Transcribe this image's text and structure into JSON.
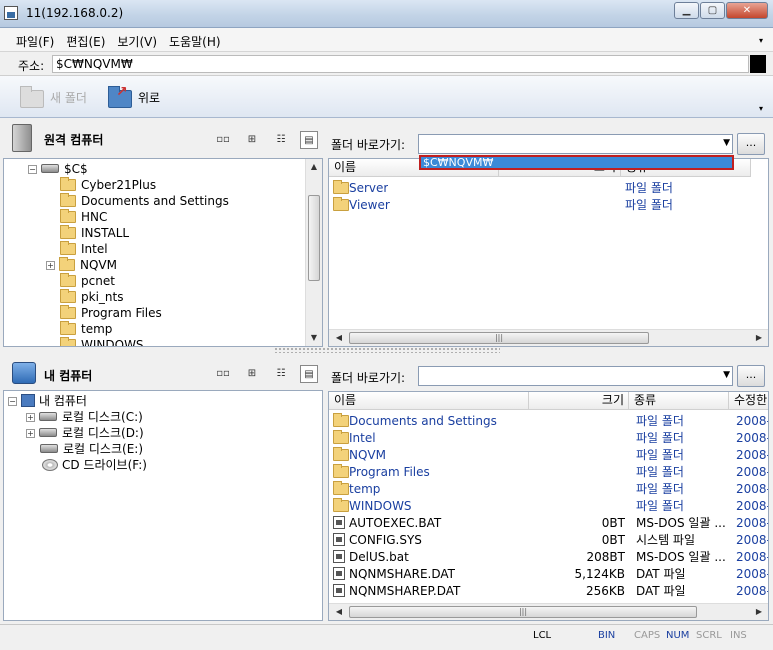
{
  "window": {
    "title": "11(192.168.0.2)"
  },
  "menu": [
    "파일(F)",
    "편집(E)",
    "보기(V)",
    "도움말(H)"
  ],
  "address": {
    "label": "주소:",
    "value": "$C₩NQVM₩"
  },
  "toolbar": {
    "new_folder": "새 폴더",
    "up": "위로"
  },
  "remote": {
    "title": "원격 컴퓨터",
    "tree_root": "$C$",
    "tree_items": [
      "Cyber21Plus",
      "Documents and Settings",
      "HNC",
      "INSTALL",
      "Intel",
      "NQVM",
      "pcnet",
      "pki_nts",
      "Program Files",
      "temp",
      "WINDOWS"
    ],
    "folder_label": "폴더 바로가기:",
    "dropdown_selected": "$C₩NQVM₩",
    "columns": [
      "이름",
      "크기",
      "종류"
    ],
    "files": [
      {
        "name": "Server",
        "type": "파일 폴더"
      },
      {
        "name": "Viewer",
        "type": "파일 폴더"
      }
    ]
  },
  "local": {
    "title": "내 컴퓨터",
    "tree_root": "내 컴퓨터",
    "tree_items": [
      "로컬 디스크(C:)",
      "로컬 디스크(D:)",
      "로컬 디스크(E:)",
      "CD 드라이브(F:)"
    ],
    "folder_label": "폴더 바로가기:",
    "columns": [
      "이름",
      "크기",
      "종류",
      "수정한"
    ],
    "files": [
      {
        "name": "Documents and Settings",
        "size": "",
        "type": "파일 폴더",
        "date": "2008-",
        "kind": "folder"
      },
      {
        "name": "Intel",
        "size": "",
        "type": "파일 폴더",
        "date": "2008-",
        "kind": "folder"
      },
      {
        "name": "NQVM",
        "size": "",
        "type": "파일 폴더",
        "date": "2008-",
        "kind": "folder"
      },
      {
        "name": "Program Files",
        "size": "",
        "type": "파일 폴더",
        "date": "2008-",
        "kind": "folder"
      },
      {
        "name": "temp",
        "size": "",
        "type": "파일 폴더",
        "date": "2008-",
        "kind": "folder"
      },
      {
        "name": "WINDOWS",
        "size": "",
        "type": "파일 폴더",
        "date": "2008-",
        "kind": "folder"
      },
      {
        "name": "AUTOEXEC.BAT",
        "size": "0BT",
        "type": "MS-DOS 일괄 ...",
        "date": "2008-",
        "kind": "file"
      },
      {
        "name": "CONFIG.SYS",
        "size": "0BT",
        "type": "시스템 파일",
        "date": "2008-",
        "kind": "file"
      },
      {
        "name": "DelUS.bat",
        "size": "208BT",
        "type": "MS-DOS 일괄 ...",
        "date": "2008-",
        "kind": "file"
      },
      {
        "name": "NQNMSHARE.DAT",
        "size": "5,124KB",
        "type": "DAT 파일",
        "date": "2008-",
        "kind": "file"
      },
      {
        "name": "NQNMSHAREP.DAT",
        "size": "256KB",
        "type": "DAT 파일",
        "date": "2008-",
        "kind": "file"
      }
    ]
  },
  "status": {
    "lcl": "LCL",
    "bin": "BIN",
    "caps": "CAPS",
    "num": "NUM",
    "scrl": "SCRL",
    "ins": "INS"
  }
}
